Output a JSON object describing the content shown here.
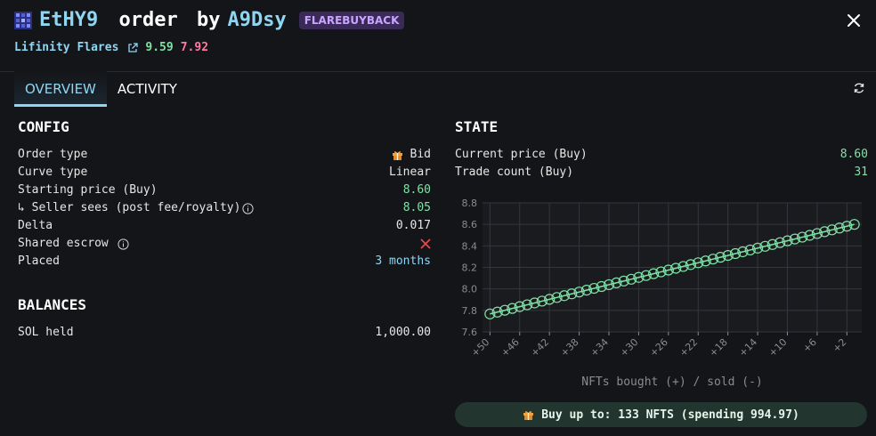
{
  "header": {
    "title_token": "EtHY9",
    "title_word": "order",
    "title_by": "by",
    "title_owner": "A9Dsy",
    "tag": "FLAREBUYBACK",
    "collection": "Lifinity Flares",
    "price_buy": "9.59",
    "price_sell": "7.92"
  },
  "tabs": [
    {
      "label": "OVERVIEW",
      "active": true
    },
    {
      "label": "ACTIVITY",
      "active": false
    }
  ],
  "config": {
    "title": "CONFIG",
    "rows": [
      {
        "label": "Order type",
        "value": "Bid"
      },
      {
        "label": "Curve type",
        "value": "Linear"
      },
      {
        "label": "Starting price (Buy)",
        "value": "8.60"
      },
      {
        "label": "↳ Seller sees (post fee/royalty)",
        "value": "8.05"
      },
      {
        "label": "Delta",
        "value": "0.017"
      },
      {
        "label": "Shared escrow",
        "value": ""
      },
      {
        "label": "Placed",
        "value": "3 months"
      }
    ]
  },
  "balances": {
    "title": "BALANCES",
    "rows": [
      {
        "label": "SOL held",
        "value": "1,000.00"
      }
    ]
  },
  "state": {
    "title": "STATE",
    "rows": [
      {
        "label": "Current price (Buy)",
        "value": "8.60"
      },
      {
        "label": "Trade count (Buy)",
        "value": "31"
      }
    ]
  },
  "buy_bar": {
    "label": "Buy up to: 133 NFTS (spending 994.97)"
  },
  "colors": {
    "accent_blue": "#8fd6f2",
    "green": "#7fe3a6",
    "pink": "#ff7aa3",
    "tag_bg": "#3a2a58",
    "tag_fg": "#c9a5ff",
    "error_red": "#e5484d"
  },
  "chart_data": {
    "type": "line",
    "xlabel": "NFTs bought (+) / sold (-)",
    "ylabel": "",
    "x": [
      50,
      49,
      48,
      47,
      46,
      45,
      44,
      43,
      42,
      41,
      40,
      39,
      38,
      37,
      36,
      35,
      34,
      33,
      32,
      31,
      30,
      29,
      28,
      27,
      26,
      25,
      24,
      23,
      22,
      21,
      20,
      19,
      18,
      17,
      16,
      15,
      14,
      13,
      12,
      11,
      10,
      9,
      8,
      7,
      6,
      5,
      4,
      3,
      2,
      1
    ],
    "x_tick_labels": [
      "+50",
      "+46",
      "+42",
      "+38",
      "+34",
      "+30",
      "+26",
      "+22",
      "+18",
      "+14",
      "+10",
      "+6",
      "+2"
    ],
    "x_tick_values": [
      50,
      46,
      42,
      38,
      34,
      30,
      26,
      22,
      18,
      14,
      10,
      6,
      2
    ],
    "y": [
      7.767,
      7.784,
      7.801,
      7.818,
      7.835,
      7.852,
      7.869,
      7.886,
      7.903,
      7.92,
      7.937,
      7.954,
      7.971,
      7.988,
      8.005,
      8.022,
      8.039,
      8.056,
      8.073,
      8.09,
      8.107,
      8.124,
      8.141,
      8.158,
      8.175,
      8.192,
      8.209,
      8.226,
      8.243,
      8.26,
      8.277,
      8.294,
      8.311,
      8.328,
      8.345,
      8.362,
      8.379,
      8.396,
      8.413,
      8.43,
      8.447,
      8.464,
      8.481,
      8.498,
      8.515,
      8.532,
      8.549,
      8.566,
      8.583,
      8.6
    ],
    "y_ticks": [
      "7.6",
      "7.8",
      "8.0",
      "8.2",
      "8.4",
      "8.6",
      "8.8"
    ],
    "ylim": [
      7.6,
      8.8
    ],
    "grid": true,
    "series_color": "#7fe3a6"
  }
}
